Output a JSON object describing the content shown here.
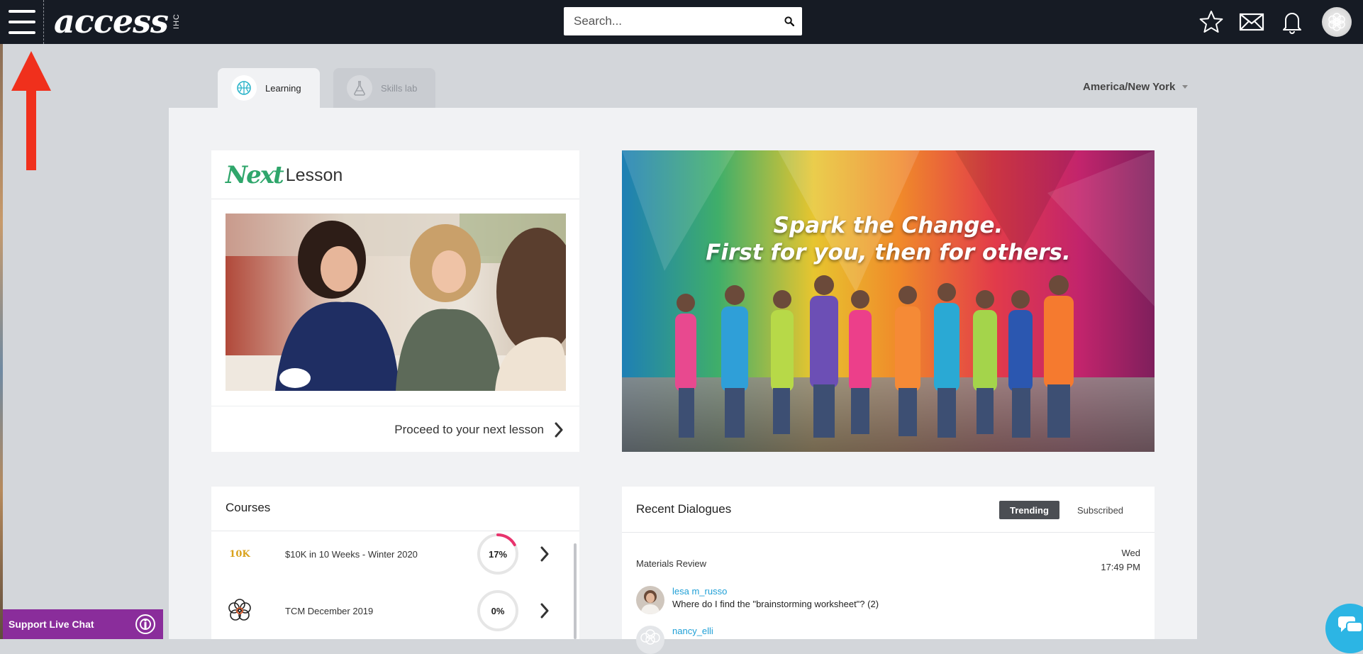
{
  "header": {
    "logo_text": "access",
    "logo_sub": "IHC",
    "search_placeholder": "Search..."
  },
  "tabs": [
    {
      "label": "Learning",
      "icon": "brain-icon",
      "active": true
    },
    {
      "label": "Skills lab",
      "icon": "flask-icon",
      "active": false
    }
  ],
  "timezone": "America/New York",
  "next_lesson": {
    "title_next": "Next",
    "title_lesson": "Lesson",
    "proceed_label": "Proceed to your next lesson"
  },
  "banner": {
    "line1": "Spark the Change.",
    "line2": "First for you, then for others."
  },
  "courses": {
    "title": "Courses",
    "items": [
      {
        "name": "$10K in 10 Weeks - Winter 2020",
        "progress": 17,
        "progress_label": "17%",
        "logo_text": "10K"
      },
      {
        "name": "TCM December 2019",
        "progress": 0,
        "progress_label": "0%"
      }
    ]
  },
  "dialogues": {
    "title": "Recent Dialogues",
    "tab_trending": "Trending",
    "tab_subscribed": "Subscribed",
    "category": "Materials Review",
    "day": "Wed",
    "time": "17:49 PM",
    "items": [
      {
        "user": "lesa m_russo",
        "message": "Where do I find the \"brainstorming worksheet\"? (2)"
      },
      {
        "user": "nancy_elli",
        "message": ""
      }
    ]
  },
  "livechat": {
    "label": "Support Live Chat"
  },
  "colors": {
    "topbar": "#161b24",
    "accent_green": "#2fa66b",
    "link_blue": "#1e9fd6",
    "progress_pink": "#e8336d",
    "livechat_purple": "#8a2d9b",
    "arrow_red": "#f0301c"
  }
}
